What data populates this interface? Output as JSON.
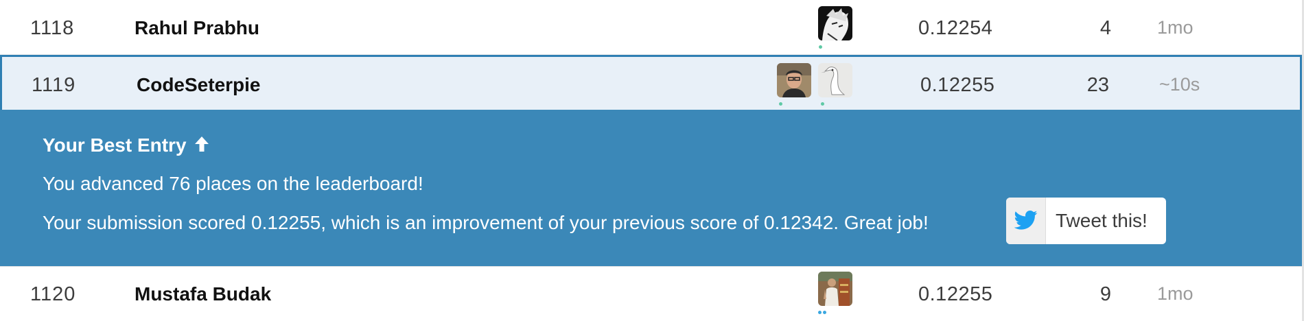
{
  "rows": [
    {
      "rank": "1118",
      "name": "Rahul Prabhu",
      "score": "0.12254",
      "entries": "4",
      "last": "1mo"
    },
    {
      "rank": "1119",
      "name": "CodeSeterpie",
      "score": "0.12255",
      "entries": "23",
      "last": "~10s"
    },
    {
      "rank": "1120",
      "name": "Mustafa Budak",
      "score": "0.12255",
      "entries": "9",
      "last": "1mo"
    }
  ],
  "banner": {
    "title": "Your Best Entry",
    "advanced": "You advanced 76 places on the leaderboard!",
    "submission": "Your submission scored 0.12255, which is an improvement of your previous score of 0.12342. Great job!",
    "tweet_label": "Tweet this!"
  },
  "colors": {
    "banner_bg": "#3b88b8",
    "highlight_row_bg": "#e8f0f8",
    "highlight_border": "#2f7fb3",
    "twitter_blue": "#1da1f2",
    "status_dot": "#5fc9a5"
  },
  "icons": {
    "arrow": "arrow-up-icon",
    "tweet": "twitter-bird-icon"
  }
}
